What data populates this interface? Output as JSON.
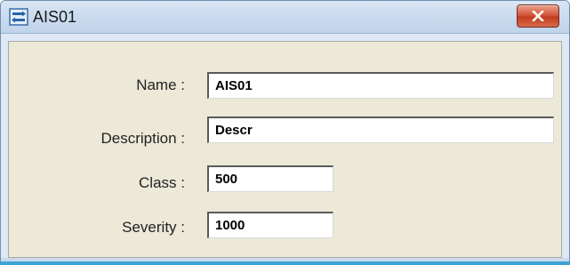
{
  "window": {
    "title": "AIS01",
    "icon": "device-config-icon",
    "close_icon": "close-icon"
  },
  "fields": {
    "name": {
      "label": "Name :",
      "value": "AIS01"
    },
    "description": {
      "label": "Description :",
      "value": "Descr"
    },
    "class": {
      "label": "Class :",
      "value": "500"
    },
    "severity": {
      "label": "Severity :",
      "value": "1000"
    }
  },
  "colors": {
    "title_bar": "#c9daee",
    "dialog_background": "#ece9d8",
    "close_button": "#c94a2c",
    "accent_line": "#3fa3d6"
  }
}
